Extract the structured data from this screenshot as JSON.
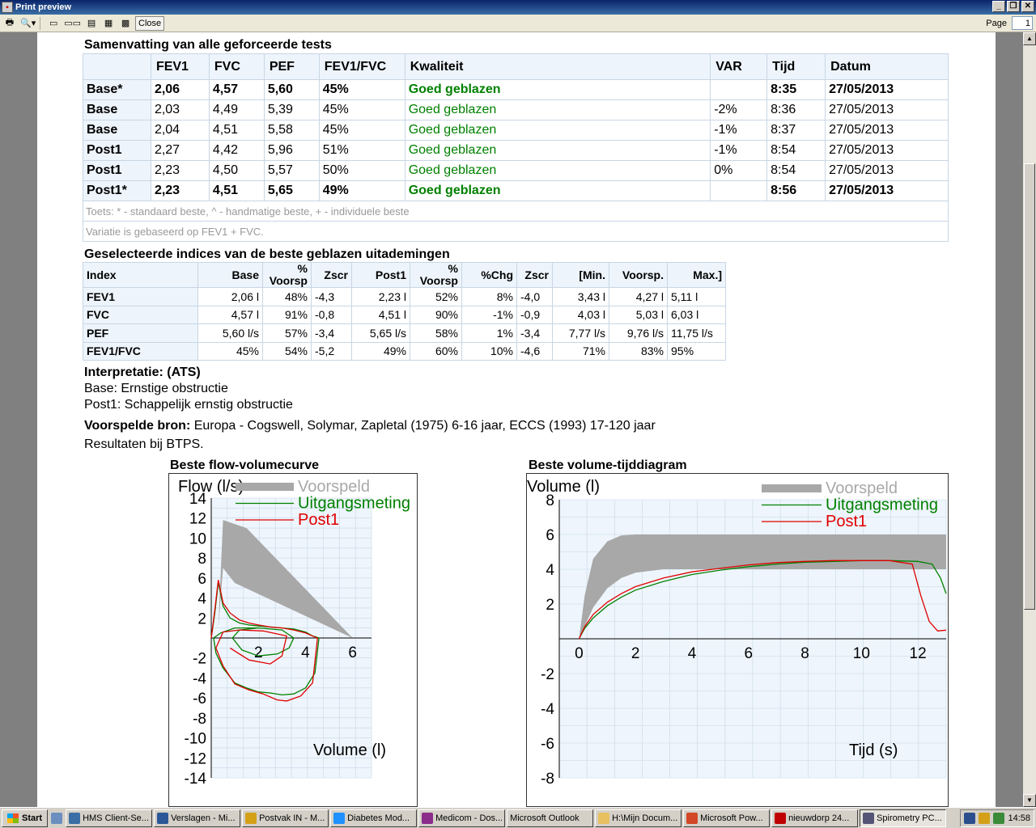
{
  "window": {
    "title": "Print preview"
  },
  "toolbar": {
    "close_label": "Close",
    "page_label": "Page",
    "page_value": "1"
  },
  "summary": {
    "title": "Samenvatting van alle geforceerde tests",
    "columns": [
      "",
      "FEV1",
      "FVC",
      "PEF",
      "FEV1/FVC",
      "Kwaliteit",
      "VAR",
      "Tijd",
      "Datum"
    ],
    "rows": [
      {
        "label": "Base*",
        "fev1": "2,06",
        "fvc": "4,57",
        "pef": "5,60",
        "ratio": "45%",
        "quality": "Goed geblazen",
        "var": "",
        "time": "8:35",
        "date": "27/05/2013",
        "best": true
      },
      {
        "label": "Base",
        "fev1": "2,03",
        "fvc": "4,49",
        "pef": "5,39",
        "ratio": "45%",
        "quality": "Goed geblazen",
        "var": "-2%",
        "time": "8:36",
        "date": "27/05/2013",
        "best": false
      },
      {
        "label": "Base",
        "fev1": "2,04",
        "fvc": "4,51",
        "pef": "5,58",
        "ratio": "45%",
        "quality": "Goed geblazen",
        "var": "-1%",
        "time": "8:37",
        "date": "27/05/2013",
        "best": false
      },
      {
        "label": "Post1",
        "fev1": "2,27",
        "fvc": "4,42",
        "pef": "5,96",
        "ratio": "51%",
        "quality": "Goed geblazen",
        "var": "-1%",
        "time": "8:54",
        "date": "27/05/2013",
        "best": false
      },
      {
        "label": "Post1",
        "fev1": "2,23",
        "fvc": "4,50",
        "pef": "5,57",
        "ratio": "50%",
        "quality": "Goed geblazen",
        "var": "0%",
        "time": "8:54",
        "date": "27/05/2013",
        "best": false
      },
      {
        "label": "Post1*",
        "fev1": "2,23",
        "fvc": "4,51",
        "pef": "5,65",
        "ratio": "49%",
        "quality": "Goed geblazen",
        "var": "",
        "time": "8:56",
        "date": "27/05/2013",
        "best": true
      }
    ],
    "note1": "Toets: * - standaard beste, ^ - handmatige beste, + - individuele beste",
    "note2": "Variatie is gebaseerd op FEV1 + FVC."
  },
  "indices": {
    "title": "Geselecteerde indices van de beste geblazen uitademingen",
    "columns": [
      "Index",
      "Base",
      "% Voorsp",
      "Zscr",
      "Post1",
      "% Voorsp",
      "%Chg",
      "Zscr",
      "[Min.",
      "Voorsp.",
      "Max.]"
    ],
    "rows": [
      [
        "FEV1",
        "2,06 l",
        "48%",
        "-4,3",
        "2,23 l",
        "52%",
        "8%",
        "-4,0",
        "3,43 l",
        "4,27 l",
        "5,11 l"
      ],
      [
        "FVC",
        "4,57 l",
        "91%",
        "-0,8",
        "4,51 l",
        "90%",
        "-1%",
        "-0,9",
        "4,03 l",
        "5,03 l",
        "6,03 l"
      ],
      [
        "PEF",
        "5,60 l/s",
        "57%",
        "-3,4",
        "5,65 l/s",
        "58%",
        "1%",
        "-3,4",
        "7,77 l/s",
        "9,76 l/s",
        "11,75 l/s"
      ],
      [
        "FEV1/FVC",
        "45%",
        "54%",
        "-5,2",
        "49%",
        "60%",
        "10%",
        "-4,6",
        "71%",
        "83%",
        "95%"
      ]
    ]
  },
  "interpretation": {
    "title": "Interpretatie: (ATS)",
    "base": "Base: Ernstige obstructie",
    "post": "Post1: Schappelijk ernstig obstructie"
  },
  "source": {
    "label": "Voorspelde bron:",
    "text": "Europa - Cogswell, Solymar, Zapletal (1975) 6-16 jaar, ECCS (1993) 17-120 jaar",
    "btps": "Resultaten bij BTPS."
  },
  "chart_data": [
    {
      "type": "line",
      "title": "Beste flow-volumecurve",
      "ylabel": "Flow (l/s)",
      "xlabel": "Volume (l)",
      "xlim": [
        0,
        6.8
      ],
      "ylim": [
        -14,
        14
      ],
      "xticks": [
        "2",
        "4",
        "6"
      ],
      "yticks": [
        "14",
        "12",
        "10",
        "8",
        "6",
        "4",
        "2",
        "-2",
        "-4",
        "-6",
        "-8",
        "-10",
        "-12",
        "-14"
      ],
      "grid": true,
      "legend_position": "top",
      "colors": {
        "predicted": "#a8a8a8",
        "base": "#008000",
        "post": "#e00000"
      },
      "series": [
        {
          "name": "Voorspeld",
          "upper": [
            [
              0.3,
              1
            ],
            [
              0.5,
              11.8
            ],
            [
              1.5,
              11
            ],
            [
              6,
              0
            ]
          ],
          "lower": [
            [
              0.5,
              7
            ],
            [
              1.0,
              5.5
            ],
            [
              6,
              0
            ]
          ]
        },
        {
          "name": "Uitgangsmeting",
          "x": [
            0,
            0.15,
            0.3,
            0.5,
            0.8,
            1.2,
            1.6,
            2.0,
            2.5,
            3.0,
            3.5,
            4.0,
            4.3,
            4.57,
            4.4,
            4.0,
            3.5,
            3.0,
            2.5,
            2.0,
            1.5,
            1.0,
            0.5,
            0.2,
            0.1,
            0.4,
            1.0,
            2.0,
            3.0,
            3.5,
            3.3,
            2.8,
            2.0,
            1.3,
            0.9,
            1.2,
            2.0
          ],
          "y": [
            0,
            2.5,
            5.6,
            3.2,
            2.0,
            1.5,
            1.3,
            1.2,
            1.1,
            1.0,
            0.9,
            0.6,
            0.2,
            0,
            -3.5,
            -5.0,
            -5.6,
            -5.7,
            -5.5,
            -5.4,
            -5.0,
            -4.5,
            -3.0,
            -1.5,
            0,
            0.5,
            1.0,
            1.0,
            0.8,
            0,
            -1.0,
            -1.6,
            -1.8,
            -1.2,
            0,
            0.8,
            1.0
          ]
        },
        {
          "name": "Post1",
          "x": [
            0,
            0.15,
            0.3,
            0.5,
            0.8,
            1.2,
            1.6,
            2.0,
            2.5,
            3.0,
            3.5,
            4.0,
            4.4,
            4.51,
            4.3,
            3.8,
            3.2,
            2.8,
            2.2,
            1.6,
            1.0,
            0.5,
            0.2,
            0.5,
            1.2,
            2.2,
            3.2,
            3.0,
            2.5,
            1.6,
            0.8
          ],
          "y": [
            0,
            2.8,
            5.8,
            3.5,
            2.5,
            1.8,
            1.5,
            1.3,
            1.1,
            1.0,
            0.8,
            0.5,
            0.1,
            0,
            -4.5,
            -5.8,
            -6.3,
            -6.2,
            -5.6,
            -5.2,
            -4.6,
            -2.8,
            -1.0,
            0.6,
            0.8,
            0.7,
            0.2,
            -1.8,
            -2.6,
            -2.2,
            -1.0
          ]
        }
      ]
    },
    {
      "type": "line",
      "title": "Beste volume-tijddiagram",
      "ylabel": "Volume (l)",
      "xlabel": "Tijd (s)",
      "xlim": [
        -0.7,
        13
      ],
      "ylim": [
        -8,
        8
      ],
      "xticks": [
        "0",
        "2",
        "4",
        "6",
        "8",
        "10",
        "12"
      ],
      "yticks": [
        "8",
        "6",
        "4",
        "2",
        "-2",
        "-4",
        "-6",
        "-8"
      ],
      "grid": true,
      "legend_position": "top-right",
      "colors": {
        "predicted": "#a8a8a8",
        "base": "#008000",
        "post": "#e00000"
      },
      "series": [
        {
          "name": "Voorspeld",
          "upper": [
            [
              0,
              0
            ],
            [
              0.2,
              2.5
            ],
            [
              0.5,
              4.6
            ],
            [
              1,
              5.6
            ],
            [
              1.5,
              5.95
            ],
            [
              2,
              6
            ],
            [
              13,
              6
            ]
          ],
          "lower": [
            [
              0,
              0
            ],
            [
              0.5,
              1.8
            ],
            [
              1,
              2.9
            ],
            [
              1.5,
              3.5
            ],
            [
              2,
              3.8
            ],
            [
              3,
              4
            ],
            [
              13,
              4
            ]
          ]
        },
        {
          "name": "Uitgangsmeting",
          "x": [
            0,
            0.2,
            0.5,
            1,
            1.5,
            2,
            3,
            4,
            5,
            6,
            7,
            8,
            9,
            10,
            11,
            12,
            12.5,
            12.8,
            13
          ],
          "y": [
            0,
            0.6,
            1.2,
            1.9,
            2.4,
            2.8,
            3.3,
            3.7,
            3.95,
            4.15,
            4.3,
            4.4,
            4.45,
            4.5,
            4.5,
            4.45,
            4.3,
            3.5,
            2.6
          ]
        },
        {
          "name": "Post1",
          "x": [
            0,
            0.2,
            0.5,
            1,
            1.5,
            2,
            3,
            4,
            5,
            6,
            7,
            8,
            9,
            10,
            11,
            11.8,
            12.1,
            12.4,
            12.7,
            13
          ],
          "y": [
            0,
            0.7,
            1.4,
            2.1,
            2.6,
            3.0,
            3.5,
            3.85,
            4.05,
            4.25,
            4.38,
            4.45,
            4.5,
            4.5,
            4.5,
            4.3,
            2.5,
            1.0,
            0.45,
            0.5
          ]
        }
      ]
    }
  ],
  "taskbar": {
    "start_label": "Start",
    "tasks": [
      "HMS Client-Se...",
      "Verslagen - Mi...",
      "Postvak IN - M...",
      "Diabetes Mod...",
      "Medicom - Dos...",
      "Microsoft Outlook",
      "H:\\Mijn Docum...",
      "Microsoft Pow...",
      "nieuwdorp 24...",
      "Spirometry PC..."
    ],
    "task_colors": [
      "#3a6ea5",
      "#2b5797",
      "#d4a017",
      "#1e90ff",
      "#8b2c8b",
      "",
      "#e8c060",
      "#d24726",
      "#c00000",
      "#555577"
    ],
    "clock": "14:58"
  }
}
